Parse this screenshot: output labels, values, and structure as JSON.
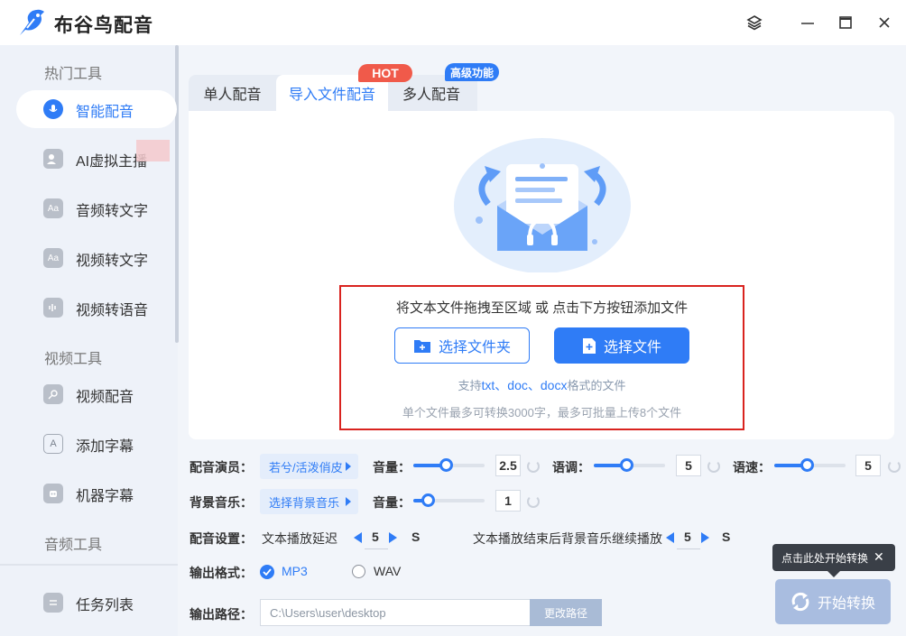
{
  "app": {
    "title": "布谷鸟配音"
  },
  "window": {
    "icons": [
      "layers-icon",
      "minimize-icon",
      "maximize-icon",
      "close-icon"
    ]
  },
  "sidebar": {
    "sections": [
      "热门工具",
      "视频工具",
      "音频工具"
    ],
    "items": [
      {
        "label": "智能配音",
        "icon": "microphone-icon",
        "active": true
      },
      {
        "label": "AI虚拟主播",
        "icon": "avatar-icon",
        "active": false
      },
      {
        "label": "音频转文字",
        "icon": "aa-text-icon",
        "active": false
      },
      {
        "label": "视频转文字",
        "icon": "video-text-icon",
        "active": false
      },
      {
        "label": "视频转语音",
        "icon": "video-audio-icon",
        "active": false
      },
      {
        "label": "视频配音",
        "icon": "video-voice-icon",
        "active": false
      },
      {
        "label": "添加字幕",
        "icon": "subtitle-icon",
        "active": false
      },
      {
        "label": "机器字幕",
        "icon": "robot-icon",
        "active": false
      }
    ],
    "task_list": "任务列表"
  },
  "tabs": [
    {
      "label": "单人配音",
      "active": false
    },
    {
      "label": "导入文件配音",
      "active": true,
      "badge": "HOT"
    },
    {
      "label": "多人配音",
      "active": false,
      "badge": "高级功能"
    }
  ],
  "upload": {
    "hint": "将文本文件拖拽至区域 或 点击下方按钮添加文件",
    "select_folder": "选择文件夹",
    "select_file": "选择文件",
    "support_prefix": "支持",
    "support_formats": "txt、doc、docx",
    "support_suffix": "格式的文件",
    "limit": "单个文件最多可转换3000字，最多可批量上传8个文件"
  },
  "settings": {
    "voice_label": "配音演员：",
    "voice_value": "若兮/活泼俏皮",
    "volume_label": "音量：",
    "volume_value": "2.5",
    "volume_level": 0.45,
    "pitch_label": "语调：",
    "pitch_value": "5",
    "pitch_level": 0.45,
    "speed_label": "语速：",
    "speed_value": "5",
    "speed_level": 0.45,
    "bgm_label": "背景音乐：",
    "bgm_value": "选择背景音乐",
    "bgm_volume_label": "音量：",
    "bgm_volume_value": "1",
    "bgm_volume_level": 0.2,
    "config_label": "配音设置：",
    "delay_label": "文本播放延迟",
    "delay_value": "5",
    "delay_unit": "S",
    "continue_label": "文本播放结束后背景音乐继续播放",
    "continue_value": "5",
    "continue_unit": "S",
    "format_label": "输出格式：",
    "format_mp3": "MP3",
    "format_wav": "WAV",
    "selected_format": "MP3",
    "path_label": "输出路径：",
    "path_value": "C:\\Users\\user\\desktop",
    "path_button": "更改路径"
  },
  "start": {
    "tooltip": "点击此处开始转换",
    "button": "开始转换"
  },
  "colors": {
    "accent": "#2f7cf6",
    "hot": "#f05a4a",
    "highlight_border": "#d9231f"
  }
}
